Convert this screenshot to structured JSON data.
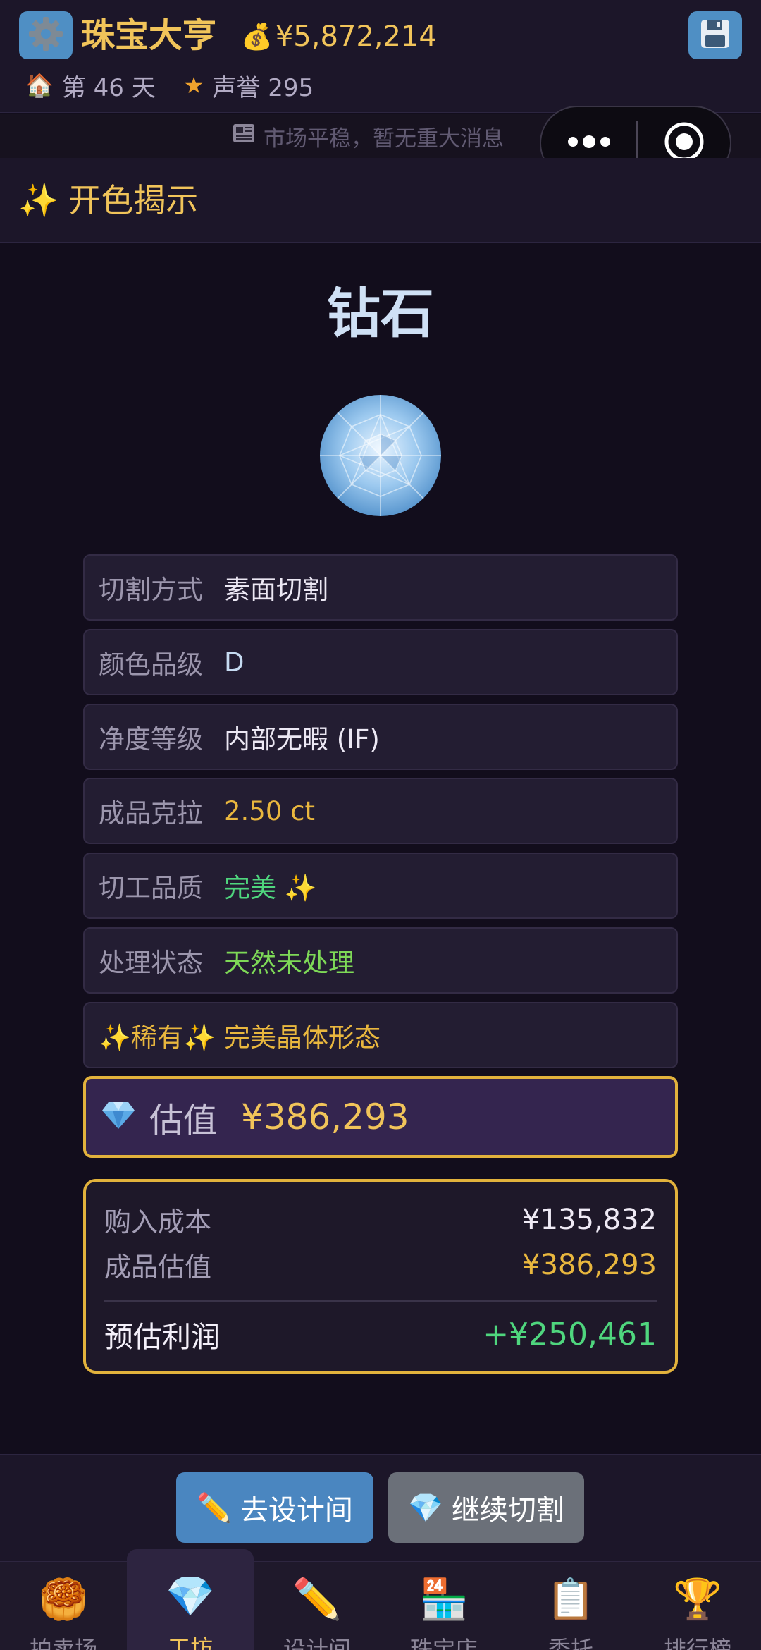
{
  "header": {
    "title": "珠宝大亨",
    "money": "¥5,872,214",
    "day": "第 46 天",
    "reputation": "声誉 295"
  },
  "news": {
    "text": "市场平稳，暂无重大消息"
  },
  "section": {
    "title": "开色揭示"
  },
  "gem": {
    "name": "钻石"
  },
  "attributes": [
    {
      "label": "切割方式",
      "value": "素面切割"
    },
    {
      "label": "颜色品级",
      "value": "D"
    },
    {
      "label": "净度等级",
      "value": "内部无暇 (IF)"
    },
    {
      "label": "成品克拉",
      "value": "2.50 ct"
    },
    {
      "label": "切工品质",
      "value": "完美 ✨"
    },
    {
      "label": "处理状态",
      "value": "天然未处理"
    },
    {
      "label": "✨稀有✨",
      "value": "完美晶体形态"
    }
  ],
  "estimate": {
    "label": "估值",
    "value": "¥386,293"
  },
  "profit": {
    "cost_label": "购入成本",
    "cost_value": "¥135,832",
    "est_label": "成品估值",
    "est_value": "¥386,293",
    "profit_label": "预估利润",
    "profit_value": "+¥250,461"
  },
  "actions": {
    "design": "去设计间",
    "continue": "继续切割"
  },
  "tabs": [
    {
      "icon": "🥮",
      "label": "拍卖场"
    },
    {
      "icon": "💎",
      "label": "工坊"
    },
    {
      "icon": "✏️",
      "label": "设计间"
    },
    {
      "icon": "🏪",
      "label": "珠宝店"
    },
    {
      "icon": "📋",
      "label": "委托"
    },
    {
      "icon": "🏆",
      "label": "排行榜"
    }
  ],
  "active_tab": "工坊",
  "colors": {
    "background": "#120d1c",
    "gold": "#f1c45a",
    "green": "#4fd67e",
    "button_blue": "#4a86c0",
    "button_grey": "#6b7079"
  },
  "icons": {
    "settings": "gear-icon",
    "money": "money-bag-icon",
    "save": "floppy-disk-icon",
    "day": "house-icon",
    "reputation": "star-icon",
    "news": "newspaper-icon",
    "section": "sparkles-icon",
    "estimate": "gem-icon"
  }
}
